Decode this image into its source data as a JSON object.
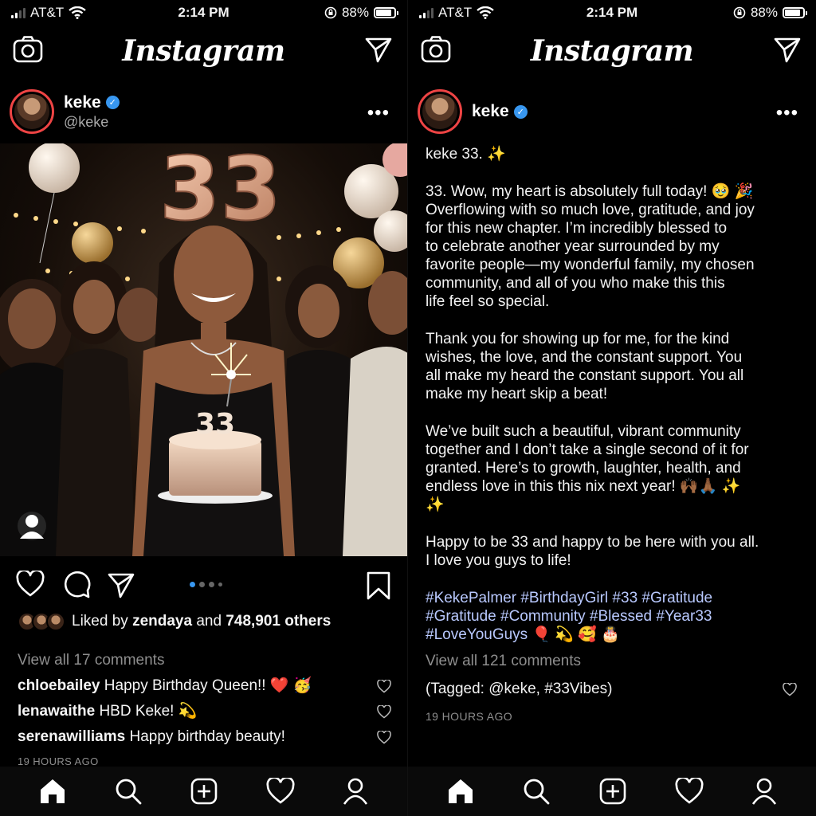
{
  "status": {
    "carrier": "AT&T",
    "time": "2:14 PM",
    "battery": "88%"
  },
  "app": {
    "logo": "Instagram"
  },
  "icons": {
    "camera": "camera-icon",
    "direct": "paper-plane-icon",
    "more": "ellipsis-icon",
    "like": "heart-icon",
    "comment": "speech-bubble-icon",
    "share": "paper-plane-icon",
    "save": "bookmark-icon",
    "home": "home-icon",
    "search": "search-icon",
    "add": "plus-square-icon",
    "activity": "heart-icon",
    "profile": "person-icon",
    "user_tag": "person-icon"
  },
  "colors": {
    "verified": "#3897f0",
    "carousel_active": "#3897f0",
    "avatar_ring": "#e44444",
    "hashtag": "#b9c9ff"
  },
  "left": {
    "post": {
      "username": "keke",
      "handle": "@keke",
      "photo": {
        "balloon_number": "33",
        "candle_number": "33"
      },
      "carousel": {
        "count": 4,
        "active": 0
      },
      "likes_prefix": "Liked by",
      "likes_user": "zendaya",
      "likes_and": "and",
      "likes_count": "748,901 others",
      "view_all": "View all 17 comments",
      "comments": [
        {
          "user": "chloebailey",
          "text": "Happy Birthday Queen!! ❤️ 🥳"
        },
        {
          "user": "lenawaithe",
          "text": "HBD Keke! 💫"
        },
        {
          "user": "serenawilliams",
          "text": "Happy birthday beauty!"
        }
      ],
      "time": "19 HOURS AGO"
    }
  },
  "right": {
    "post": {
      "username": "keke",
      "caption_title": "keke 33. ✨",
      "paragraphs": [
        "33. Wow, my heart is absolutely full today! 🥹 🎉\nOverflowing with so much love, gratitude, and joy\nfor this new chapter. I’m incredibly blessed to\nto celebrate another year surrounded by my\nfavorite people—my wonderful family, my chosen\ncommunity, and all of you who make this this\nlife feel so special.",
        "Thank you for showing up for me, for the kind\nwishes, the love, and the constant support. You\nall make my heard the constant support. You all\nmake my heart skip a beat!",
        "We’ve built such a beautiful, vibrant community\ntogether and I don’t take a single second of it for\ngranted. Here’s to growth, laughter, health, and\nendless love in this this nix next year! 🙌🏾🙏🏾 ✨\n✨",
        "Happy to be 33 and happy to be here with you all.\nI love you guys to life!"
      ],
      "hashtags": "#KekePalmer #BirthdayGirl #33 #Gratitude\n#Gratitude #Community #Blessed #Year33\n#LoveYouGuys 🎈 💫 🥰 🎂",
      "view_all": "View all 121 comments",
      "tagged": "(Tagged: @keke, #33Vibes)",
      "time": "19 HOURS AGO"
    }
  }
}
